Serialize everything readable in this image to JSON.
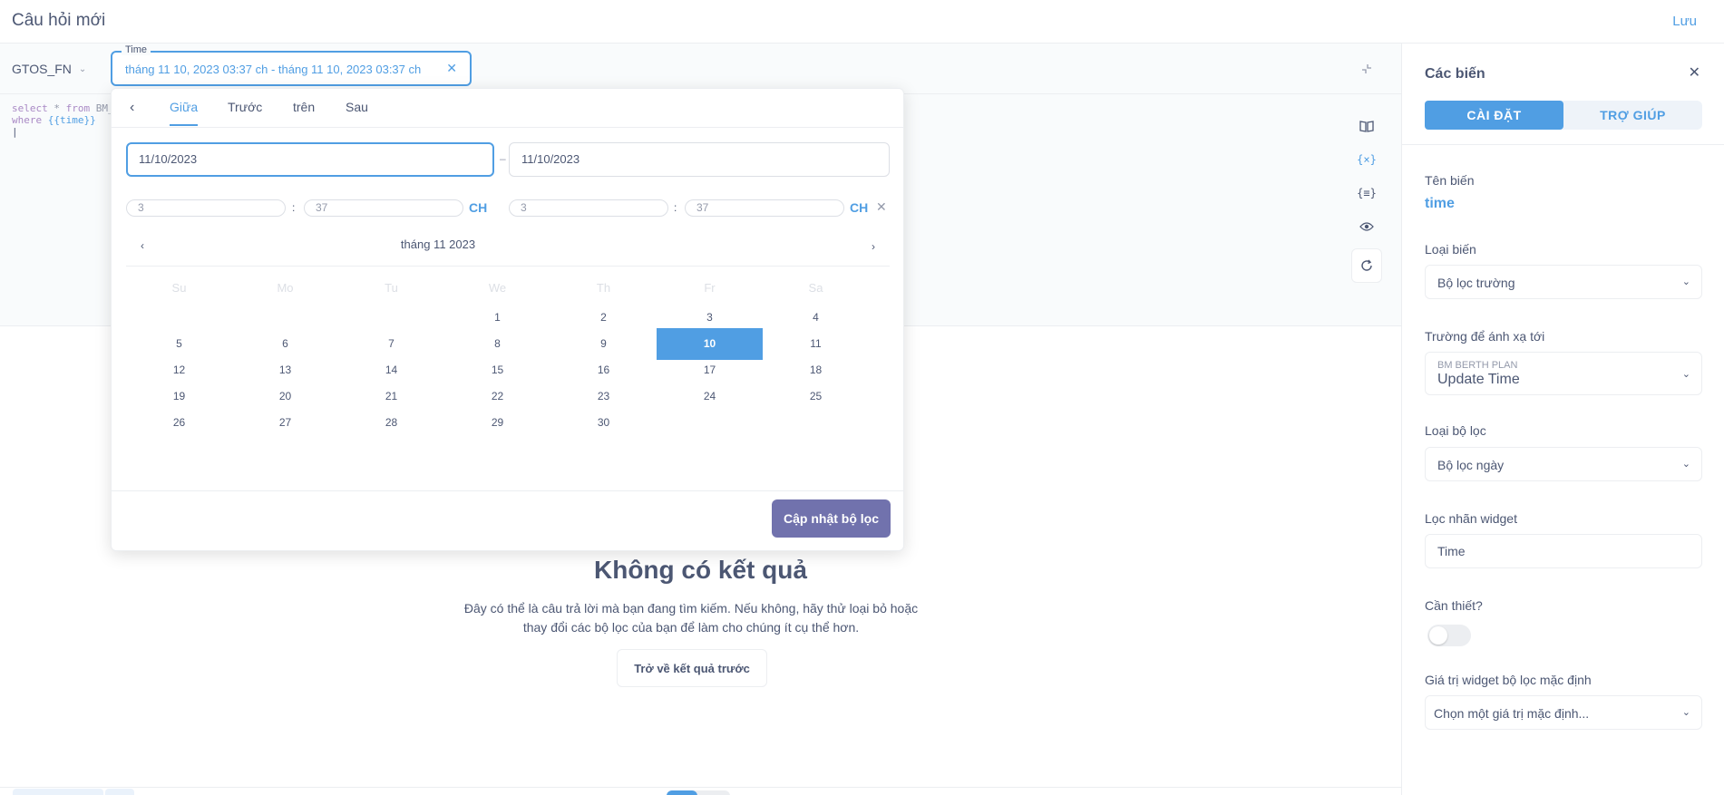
{
  "header": {
    "title": "Câu hỏi mới",
    "save_label": "Lưu"
  },
  "editor": {
    "database": "GTOS_FN",
    "filter_widget": {
      "label": "Time",
      "value": "tháng 11 10, 2023 03:37 ch - tháng 11 10, 2023 03:37 ch"
    },
    "sql_line1_kw": "select",
    "sql_line1_rest": " * ",
    "sql_line1_from": "from",
    "sql_line1_table": " BM_",
    "sql_line2_kw": "where",
    "sql_line2_var": "{{time}}",
    "tools": [
      "book-icon",
      "variable-icon",
      "snippet-icon",
      "preview-icon",
      "refresh-icon"
    ],
    "tool_variable_glyph": "{×}",
    "tool_snippet_glyph": "{≡}"
  },
  "date_picker": {
    "tabs": [
      "Giữa",
      "Trước",
      "trên",
      "Sau"
    ],
    "active_tab": "Giữa",
    "start_date": "11/10/2023",
    "end_date": "11/10/2023",
    "start_hour": "3",
    "start_minute": "37",
    "end_hour": "3",
    "end_minute": "37",
    "ampm": "CH",
    "month_label": "tháng 11 2023",
    "weekdays": [
      "Su",
      "Mo",
      "Tu",
      "We",
      "Th",
      "Fr",
      "Sa"
    ],
    "first_weekday_index": 3,
    "days_in_month": 30,
    "selected_day": 10,
    "apply_label": "Cập nhật bộ lọc"
  },
  "empty_state": {
    "title": "Không có kết quả",
    "message_line1": "Đây có thể là câu trả lời mà bạn đang tìm kiếm. Nếu không, hãy thử loại bỏ hoặc",
    "message_line2": "thay đổi các bộ lọc của bạn để làm cho chúng ít cụ thể hơn.",
    "back_label": "Trở về kết quả trước"
  },
  "sidebar": {
    "title": "Các biến",
    "tabs": [
      "CÀI ĐẶT",
      "TRỢ GIÚP"
    ],
    "var_name_label": "Tên biến",
    "var_name": "time",
    "var_type_label": "Loại biến",
    "var_type": "Bộ lọc trường",
    "field_label": "Trường để ánh xạ tới",
    "field_table": "BM BERTH PLAN",
    "field_name": "Update Time",
    "filter_type_label": "Loại bộ lọc",
    "filter_type": "Bộ lọc ngày",
    "widget_label_label": "Lọc nhãn widget",
    "widget_label": "Time",
    "required_label": "Cần thiết?",
    "required": false,
    "default_label": "Giá trị widget bộ lọc mặc định",
    "default_placeholder": "Chọn một giá trị mặc định..."
  },
  "colors": {
    "brand": "#509ee3",
    "text": "#4c5773",
    "apply_button": "#7172ad"
  }
}
